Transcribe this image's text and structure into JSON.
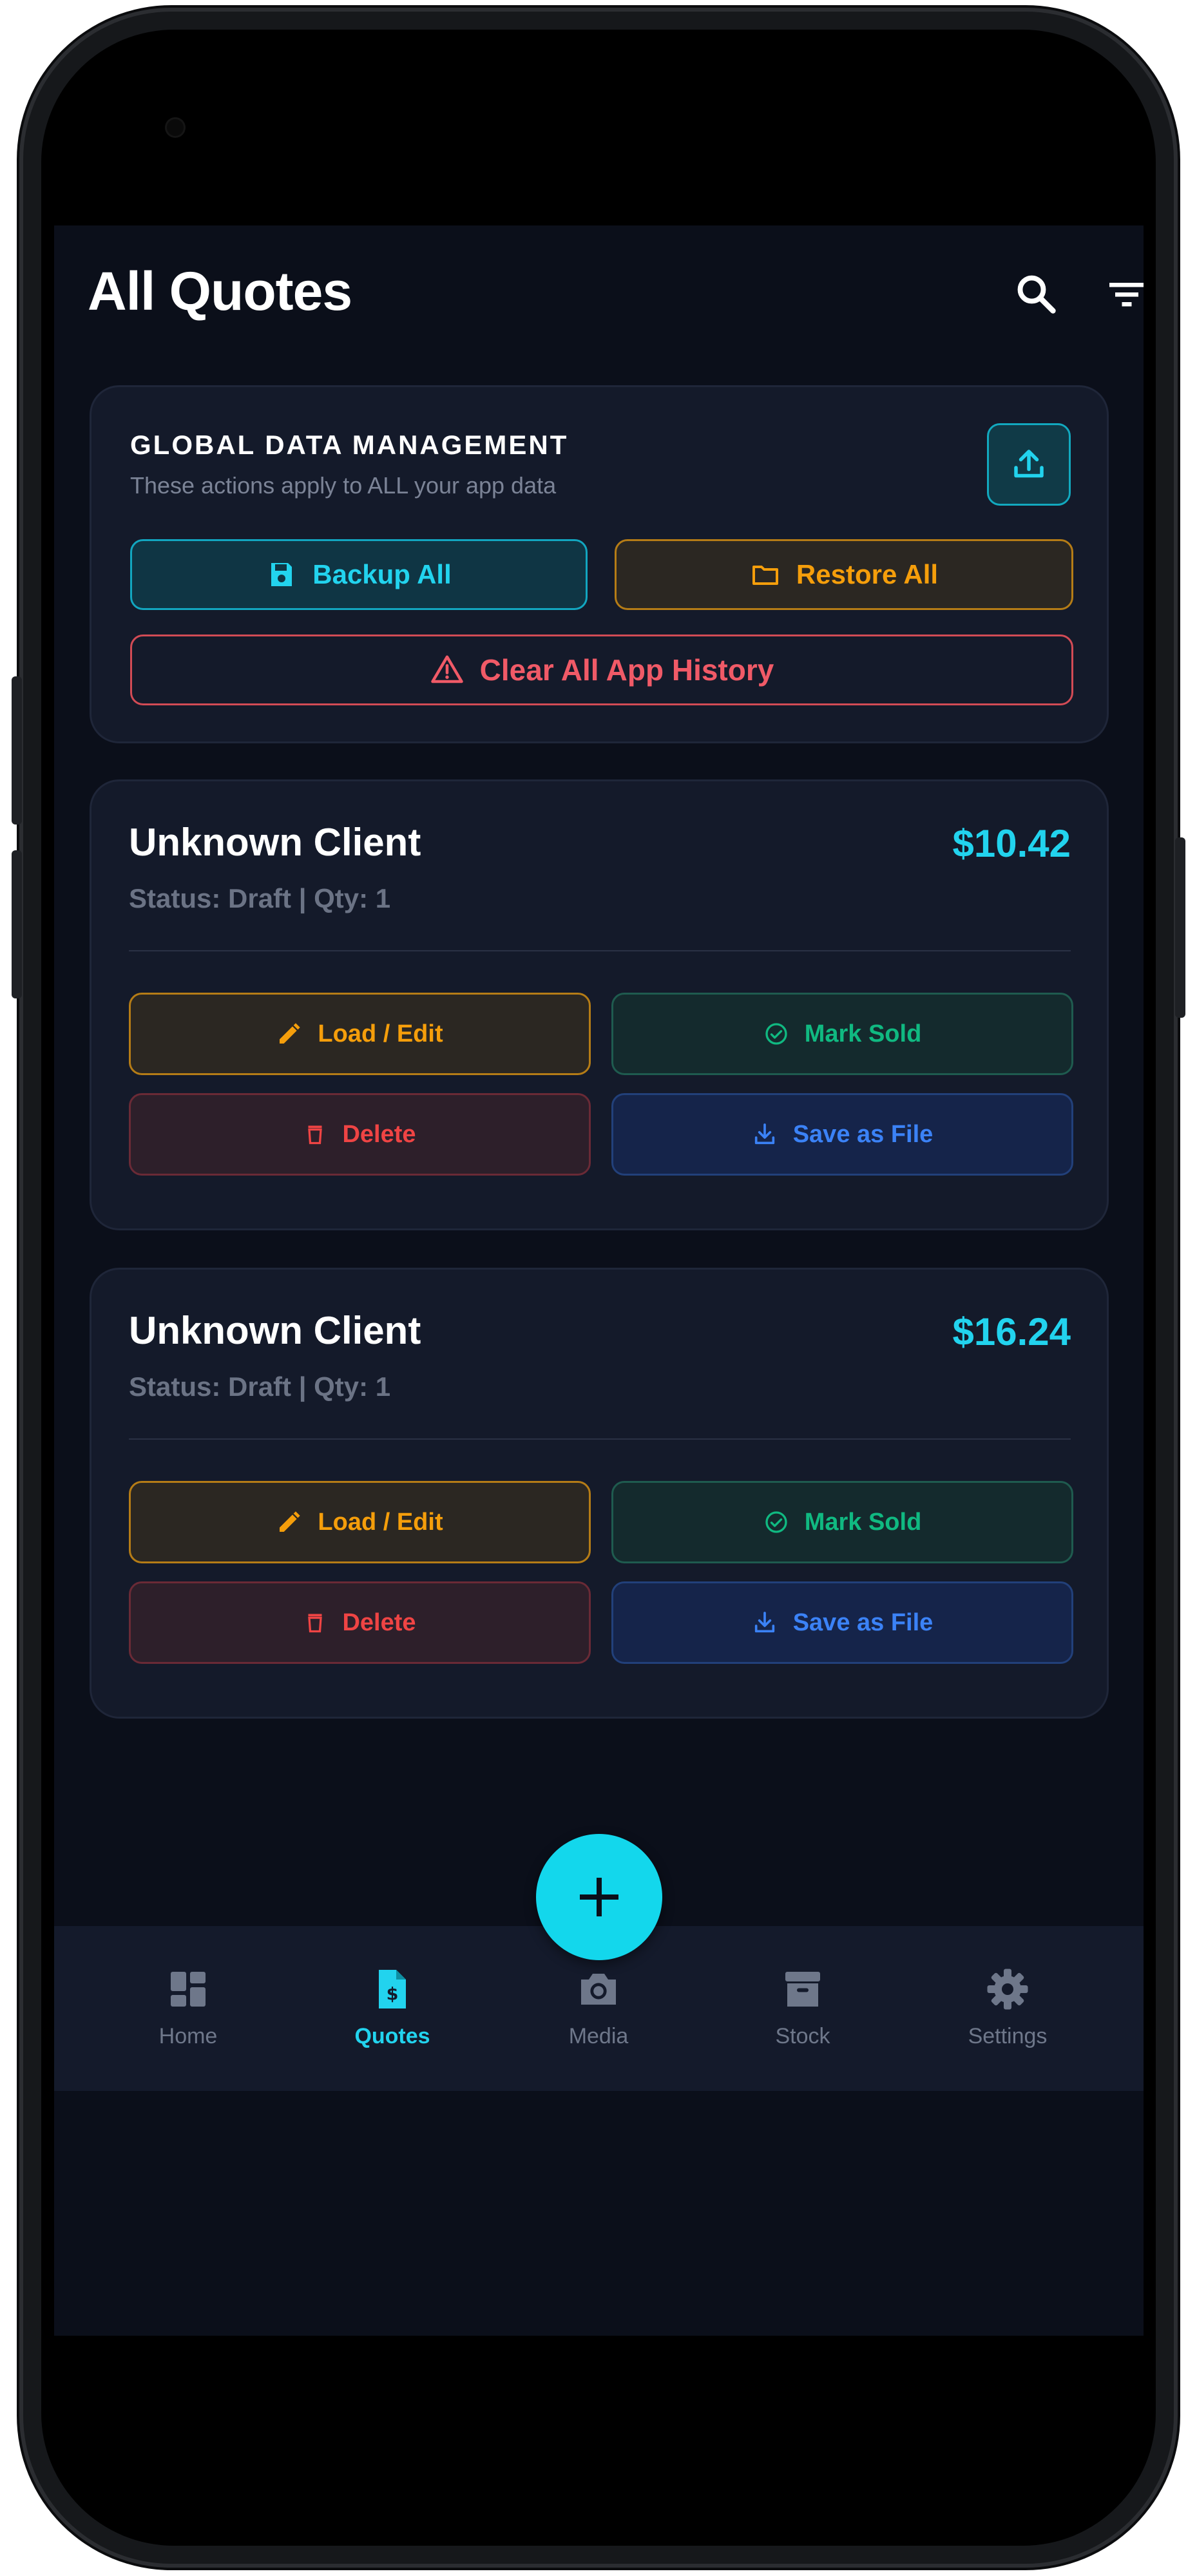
{
  "header": {
    "title": "All Quotes"
  },
  "global_data": {
    "title": "GLOBAL DATA MANAGEMENT",
    "subtitle": "These actions apply to ALL your app data",
    "backup_label": "Backup All",
    "restore_label": "Restore All",
    "clear_label": "Clear All App History"
  },
  "quotes": [
    {
      "client": "Unknown Client",
      "amount": "$10.42",
      "status": "Status: Draft | Qty: 1",
      "load_label": "Load / Edit",
      "sold_label": "Mark Sold",
      "delete_label": "Delete",
      "save_label": "Save as File"
    },
    {
      "client": "Unknown Client",
      "amount": "$16.24",
      "status": "Status: Draft | Qty: 1",
      "load_label": "Load / Edit",
      "sold_label": "Mark Sold",
      "delete_label": "Delete",
      "save_label": "Save as File"
    }
  ],
  "nav": {
    "items": [
      {
        "label": "Home",
        "icon": "dashboard-icon"
      },
      {
        "label": "Quotes",
        "icon": "quote-document-icon",
        "active": true
      },
      {
        "label": "Media",
        "icon": "camera-icon"
      },
      {
        "label": "Stock",
        "icon": "archive-box-icon"
      },
      {
        "label": "Settings",
        "icon": "gear-icon"
      }
    ]
  },
  "colors": {
    "accent": "#22d3ee",
    "background": "#0b0f1a",
    "card": "#141a2a",
    "amber": "#f59e0b",
    "green": "#10b981",
    "red": "#ef4444",
    "blue": "#3b82f6"
  }
}
